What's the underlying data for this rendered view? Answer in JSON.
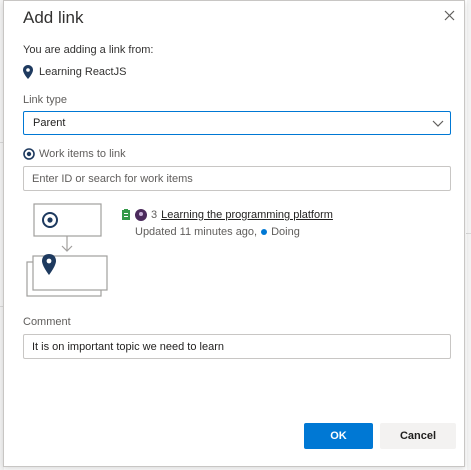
{
  "dialog": {
    "title": "Add link",
    "subtitle": "You are adding a link from:",
    "source_item": "Learning ReactJS",
    "link_type_label": "Link type",
    "link_type_value": "Parent",
    "work_items_label": "Work items to link",
    "search_placeholder": "Enter ID or search for work items",
    "linked_item": {
      "id": "3",
      "title": "Learning the programming platform",
      "updated": "Updated 11 minutes ago,",
      "state": "Doing"
    },
    "comment_label": "Comment",
    "comment_value": "It is on important topic we need to learn",
    "ok_label": "OK",
    "cancel_label": "Cancel"
  },
  "colors": {
    "accent": "#0078d4",
    "state_doing": "#0078d4",
    "map_pin": "#1e3a5f"
  },
  "icons": [
    "close-icon",
    "map-pin-icon",
    "chevron-down-icon",
    "radio-selected-icon",
    "work-item-type-icon",
    "avatar-icon",
    "link-diagram"
  ]
}
